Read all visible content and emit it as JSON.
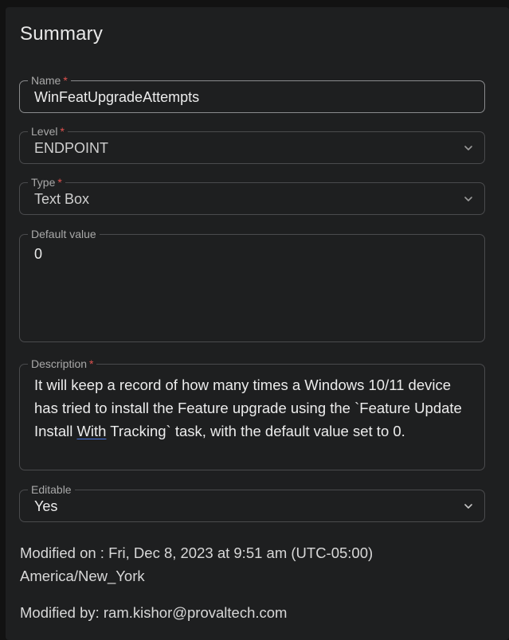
{
  "summary": {
    "title": "Summary"
  },
  "fields": {
    "name": {
      "label": "Name",
      "required_mark": "*",
      "value": "WinFeatUpgradeAttempts"
    },
    "level": {
      "label": "Level",
      "required_mark": "*",
      "value": "ENDPOINT",
      "icon": "chevron-down-icon"
    },
    "type": {
      "label": "Type",
      "required_mark": "*",
      "value": "Text Box",
      "icon": "chevron-down-icon"
    },
    "default_value": {
      "label": "Default value",
      "value": "0"
    },
    "description": {
      "label": "Description",
      "required_mark": "*",
      "text_before": "It will keep a record of how many times a Windows 10/11 device has tried to install the Feature upgrade using the `Feature Update Install ",
      "text_underlined": "With",
      "text_after": " Tracking` task, with the default value set to 0."
    },
    "editable": {
      "label": "Editable",
      "value": "Yes",
      "icon": "chevron-down-icon"
    }
  },
  "meta": {
    "modified_on": "Modified on : Fri, Dec 8, 2023 at 9:51 am (UTC-05:00) America/New_York",
    "modified_by": "Modified by: ram.kishor@provaltech.com"
  },
  "colors": {
    "background": "#121212",
    "panel": "#1e1f20",
    "border": "#4a4b4d",
    "required": "#e0524f",
    "spellcheck_underline": "#4a78e8"
  }
}
